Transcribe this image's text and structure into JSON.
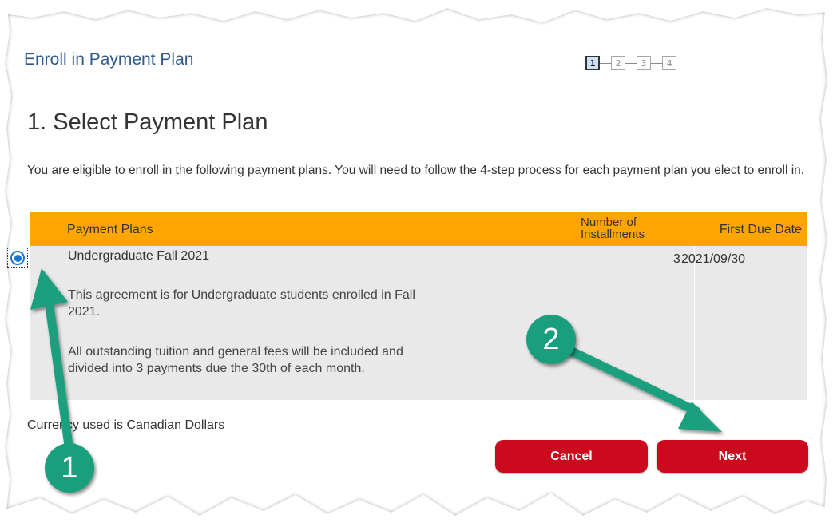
{
  "header": {
    "title": "Enroll in Payment Plan",
    "steps": [
      "1",
      "2",
      "3",
      "4"
    ],
    "active_step": 1
  },
  "page": {
    "heading": "1. Select Payment Plan",
    "intro": "You are eligible to enroll in the following payment plans. You will need to follow the 4-step process for each payment plan you elect to enroll in."
  },
  "table": {
    "headers": {
      "plans": "Payment Plans",
      "installments": "Number of Installments",
      "first_due": "First Due Date"
    },
    "rows": [
      {
        "name": "Undergraduate Fall 2021",
        "description_1": "This agreement is for Undergraduate students enrolled in Fall 2021.",
        "description_2": "All outstanding tuition and general fees will be included and divided into 3 payments due the 30th of each month.",
        "installments": "3",
        "first_due": "2021/09/30",
        "selected": true
      }
    ]
  },
  "currency_note": "Currency used is Canadian Dollars",
  "actions": {
    "cancel": "Cancel",
    "next": "Next"
  },
  "annotations": {
    "callout_1": "1",
    "callout_2": "2",
    "color": "#1a9f7e"
  },
  "colors": {
    "header_text": "#2f5a8a",
    "table_header_bg": "#ffa500",
    "table_row_bg": "#e9e9e9",
    "button_bg": "#cc0a1e",
    "radio": "#1976d2"
  }
}
